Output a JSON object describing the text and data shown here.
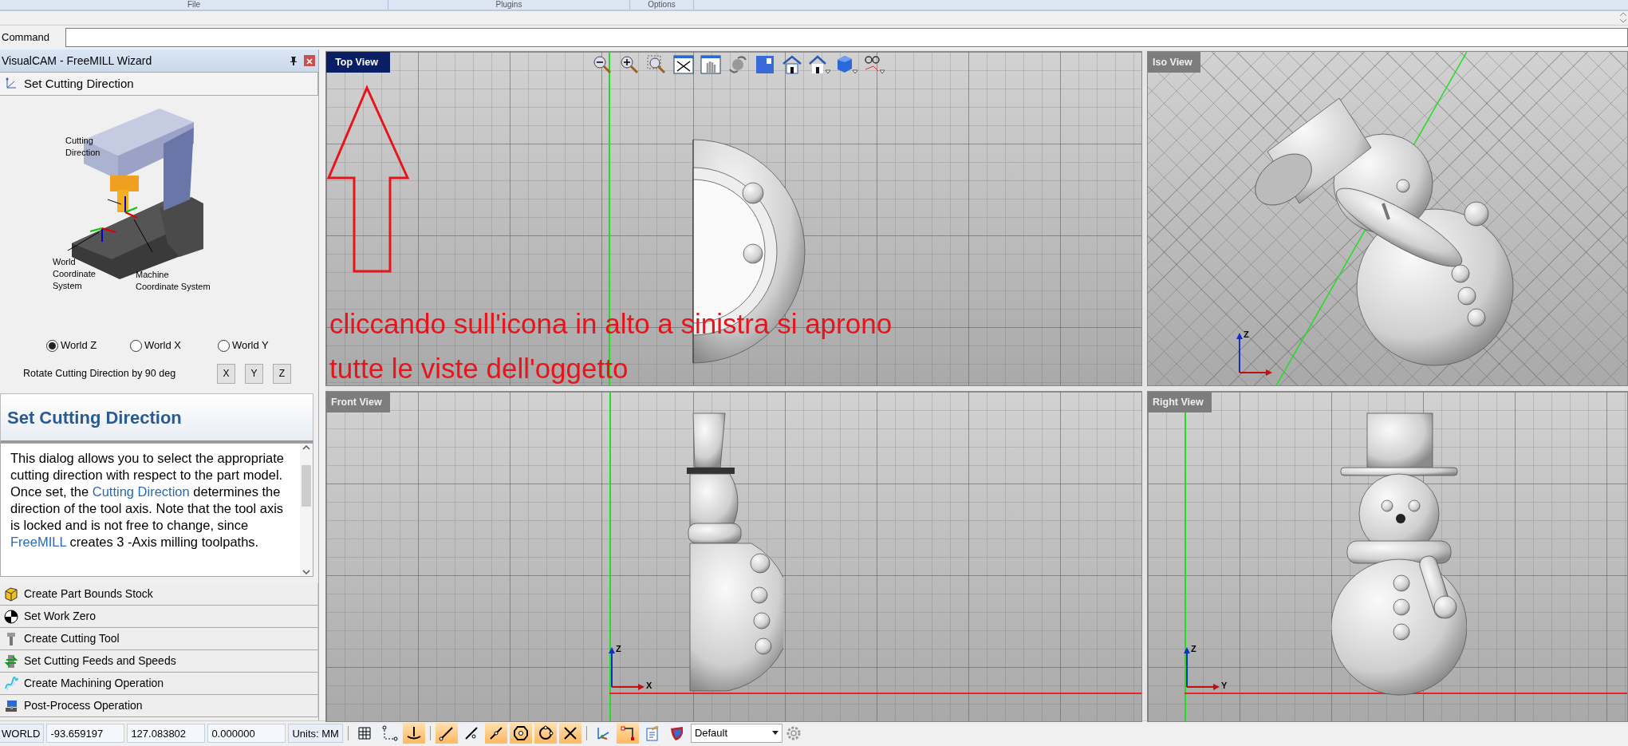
{
  "menu_bar": {
    "items": [
      "File",
      "Plugins",
      "Options"
    ]
  },
  "command": {
    "label": "Command"
  },
  "wizard": {
    "title": "VisualCAM - FreeMILL Wizard",
    "current_step": "Set Cutting Direction",
    "illustration_labels": [
      [
        "Cutting",
        "Direction"
      ],
      [
        "World",
        "Coordinate",
        "System"
      ],
      [
        "Machine",
        "Coordinate System"
      ]
    ],
    "direction_options": [
      {
        "label": "World Z",
        "selected": true
      },
      {
        "label": "World X",
        "selected": false
      },
      {
        "label": "World Y",
        "selected": false
      }
    ],
    "rotate_label": "Rotate Cutting Direction by 90 deg",
    "rotate_buttons": [
      "X",
      "Y",
      "Z"
    ],
    "help_title": "Set Cutting Direction",
    "help_text": [
      {
        "kind": "text",
        "text": "This dialog allows you to select the appropriate cutting direction with respect to the part model.  Once set, the "
      },
      {
        "kind": "link",
        "text": "Cutting Direction"
      },
      {
        "kind": "text",
        "text": " determines the direction of the tool axis.  Note that the tool axis is locked and is not free to change, since "
      },
      {
        "kind": "link",
        "text": "FreeMILL"
      },
      {
        "kind": "text",
        "text": " creates 3 -Axis milling toolpaths."
      }
    ],
    "steps": [
      {
        "label": "Create Part Bounds Stock",
        "kind": "stock"
      },
      {
        "label": "Set Work Zero",
        "kind": "zero"
      },
      {
        "label": "Create Cutting Tool",
        "kind": "tool"
      },
      {
        "label": "Set Cutting Feeds and Speeds",
        "kind": "feeds"
      },
      {
        "label": "Create Machining Operation",
        "kind": "operation"
      },
      {
        "label": "Post-Process Operation",
        "kind": "post"
      }
    ]
  },
  "viewports": [
    {
      "title": "Top View",
      "kind": "top",
      "active": true
    },
    {
      "title": "Iso View",
      "kind": "iso",
      "active": false,
      "axis_labels": [
        "Z"
      ]
    },
    {
      "title": "Front View",
      "kind": "front",
      "active": false,
      "axis_labels": [
        "Z",
        "X"
      ]
    },
    {
      "title": "Right View",
      "kind": "right",
      "active": false,
      "axis_labels": [
        "Z",
        "Y"
      ]
    }
  ],
  "annotation": {
    "lines": [
      "cliccando sull'icona in alto a sinistra si aprono",
      "tutte le viste dell'oggetto"
    ]
  },
  "status_bar": {
    "coord_system": "WORLD",
    "fields": [
      "-93.659197",
      "127.083802",
      "0.000000"
    ],
    "units": "Units: MM",
    "toggles": [
      {
        "kind": "grid",
        "on": false
      },
      {
        "kind": "ortho",
        "on": false
      },
      {
        "kind": "perp",
        "on": true
      },
      {
        "kind": "end",
        "on": true
      },
      {
        "kind": "point",
        "on": false
      },
      {
        "kind": "mid",
        "on": true
      },
      {
        "kind": "center",
        "on": true
      },
      {
        "kind": "quad",
        "on": true
      },
      {
        "kind": "intersect",
        "on": true
      },
      {
        "kind": "axes",
        "on": false
      },
      {
        "kind": "corner",
        "on": true
      },
      {
        "kind": "clipboard",
        "on": false
      },
      {
        "kind": "shield",
        "on": false
      }
    ],
    "style_select": "Default"
  }
}
